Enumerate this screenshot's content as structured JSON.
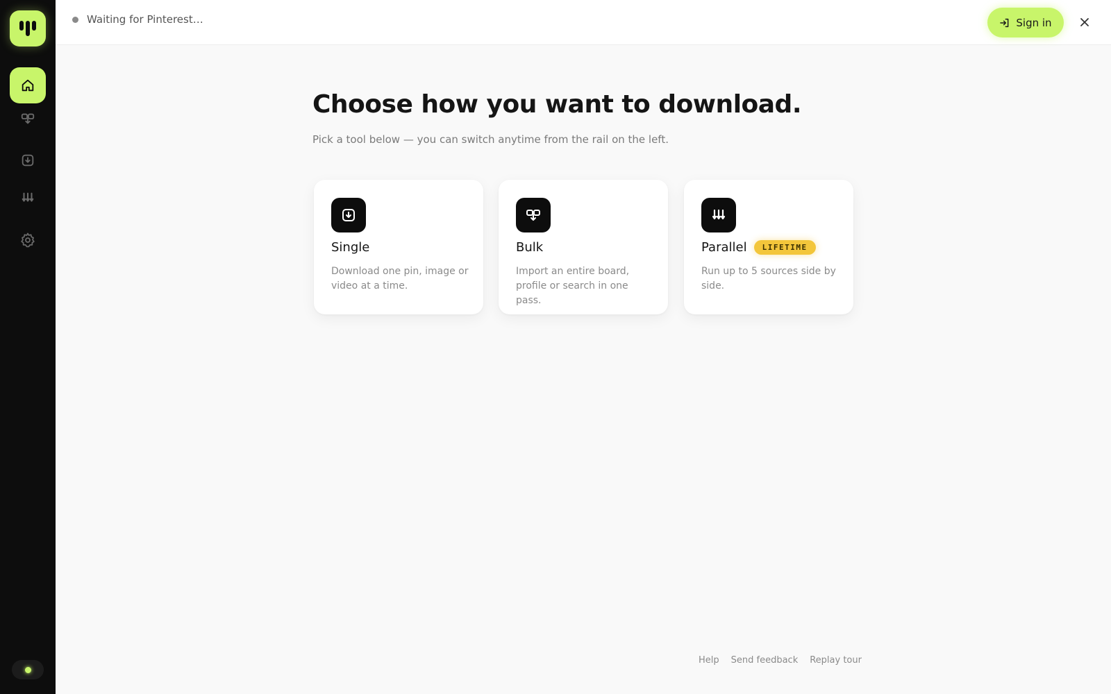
{
  "topbar": {
    "status_text": "Waiting for Pinterest…",
    "signin_label": "Sign in",
    "close_symbol": "✕"
  },
  "rail": {
    "items": [
      {
        "icon": "home-icon",
        "active": true
      },
      {
        "icon": "bulk-icon",
        "active": false
      },
      {
        "icon": "single-icon",
        "active": false
      },
      {
        "icon": "parallel-icon",
        "active": false
      },
      {
        "icon": "gear-icon",
        "active": false
      }
    ]
  },
  "main": {
    "title": "Choose how you want to download.",
    "subtitle": "Pick a tool below — you can switch anytime from the rail on the left.",
    "cards": [
      {
        "title": "Single",
        "description": "Download one pin, image or video at a time.",
        "icon": "single-download-icon"
      },
      {
        "title": "Bulk",
        "description": "Import an entire board, profile or search in one pass.",
        "icon": "bulk-download-icon"
      },
      {
        "title": "Parallel",
        "badge": "LIFETIME",
        "description": "Run up to 5 sources side by side.",
        "icon": "parallel-download-icon"
      }
    ]
  },
  "footer": {
    "links": [
      "Help",
      "Send feedback",
      "Replay tour"
    ]
  },
  "colors": {
    "accent": "#c8f56a",
    "rail_bg": "#0d0d0d",
    "badge": "#f3c63b",
    "page_bg": "#f9f9f9"
  }
}
